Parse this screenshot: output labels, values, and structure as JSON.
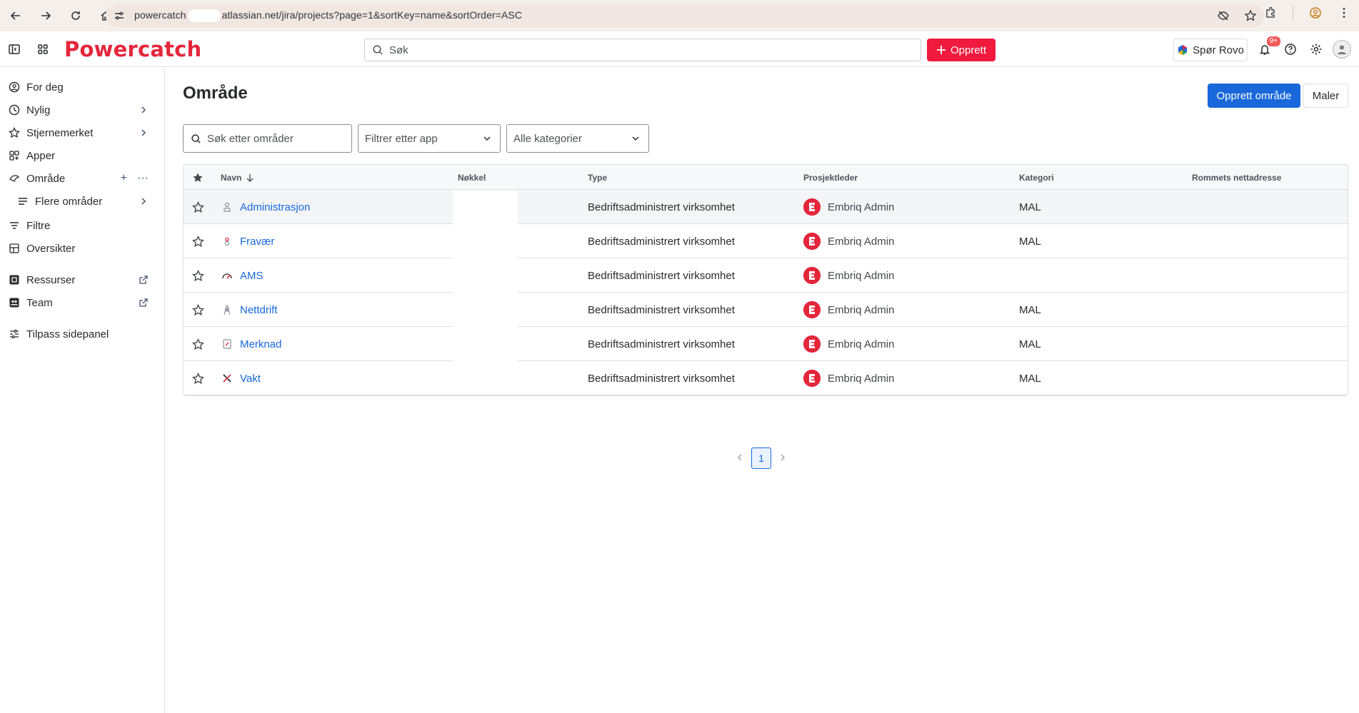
{
  "browser": {
    "url_prefix": "powercatch",
    "url_suffix": "atlassian.net/jira/projects?page=1&sortKey=name&sortOrder=ASC"
  },
  "topnav": {
    "brand": "Powercatch",
    "search_placeholder": "Søk",
    "create_label": "Opprett",
    "rovo_label": "Spør Rovo",
    "notification_badge": "9+",
    "brand_color": "#e4263b",
    "create_color": "#ef1a3e"
  },
  "sidebar": {
    "items": [
      {
        "label": "For deg",
        "icon": "user-circle-icon"
      },
      {
        "label": "Nylig",
        "icon": "clock-icon"
      },
      {
        "label": "Stjernemerket",
        "icon": "star-icon"
      },
      {
        "label": "Apper",
        "icon": "apps-icon"
      },
      {
        "label": "Område",
        "icon": "space-icon"
      },
      {
        "label": "Flere områder",
        "icon": "list-icon"
      },
      {
        "label": "Filtre",
        "icon": "filter-icon"
      },
      {
        "label": "Oversikter",
        "icon": "dashboard-icon"
      },
      {
        "label": "Ressurser",
        "icon": "resources-icon"
      },
      {
        "label": "Team",
        "icon": "team-icon"
      },
      {
        "label": "Tilpass sidepanel",
        "icon": "customize-icon"
      }
    ]
  },
  "main": {
    "title": "Område",
    "create_space_label": "Opprett område",
    "templates_label": "Maler",
    "search_placeholder": "Søk etter områder",
    "app_filter": "Filtrer etter app",
    "category_filter": "Alle kategorier",
    "primary_color": "#1868db"
  },
  "table": {
    "columns": [
      "Navn",
      "Nøkkel",
      "Type",
      "Prosjektleder",
      "Kategori",
      "Rommets nettadresse"
    ],
    "rows": [
      {
        "name": "Administrasjon",
        "type": "Bedriftsadministrert virksomhet",
        "lead": "Embriq Admin",
        "category": "MAL",
        "icon": "person-icon"
      },
      {
        "name": "Fravær",
        "type": "Bedriftsadministrert virksomhet",
        "lead": "Embriq Admin",
        "category": "MAL",
        "icon": "absence-icon"
      },
      {
        "name": "AMS",
        "type": "Bedriftsadministrert virksomhet",
        "lead": "Embriq Admin",
        "category": "",
        "icon": "gauge-icon"
      },
      {
        "name": "Nettdrift",
        "type": "Bedriftsadministrert virksomhet",
        "lead": "Embriq Admin",
        "category": "MAL",
        "icon": "pylon-icon"
      },
      {
        "name": "Merknad",
        "type": "Bedriftsadministrert virksomhet",
        "lead": "Embriq Admin",
        "category": "MAL",
        "icon": "note-icon"
      },
      {
        "name": "Vakt",
        "type": "Bedriftsadministrert virksomhet",
        "lead": "Embriq Admin",
        "category": "MAL",
        "icon": "tools-icon"
      }
    ]
  },
  "pagination": {
    "current_page": "1"
  }
}
